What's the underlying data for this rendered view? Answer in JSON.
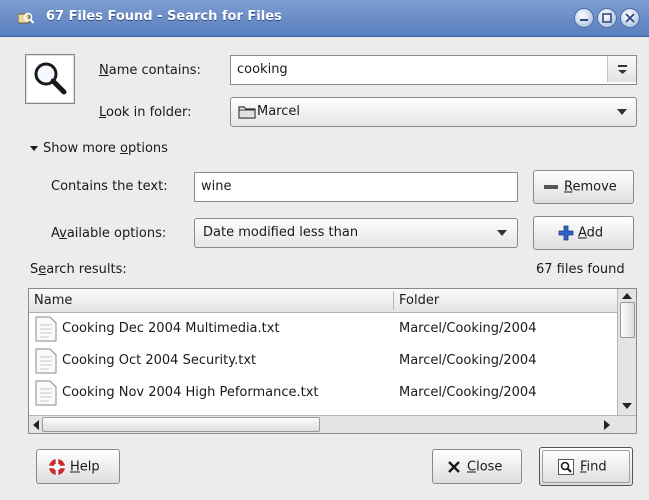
{
  "window": {
    "title": "67 Files Found - Search for Files"
  },
  "name_contains": {
    "label_pre": "",
    "label_ul": "N",
    "label_post": "ame contains:",
    "value": "cooking"
  },
  "look_in": {
    "label_pre": "",
    "label_ul": "L",
    "label_post": "ook in folder:",
    "value": "Marcel"
  },
  "more_options": {
    "label_pre": "Show more ",
    "label_ul": "o",
    "label_post": "ptions"
  },
  "contains_text": {
    "label": "Contains the text:",
    "value": "wine"
  },
  "remove_button": {
    "label_ul": "R",
    "label_post": "emove"
  },
  "available_options": {
    "label_pre": "A",
    "label_ul": "v",
    "label_post": "ailable options:",
    "value": "Date modified less than"
  },
  "add_button": {
    "label_ul": "A",
    "label_post": "dd"
  },
  "results": {
    "label_pre": "S",
    "label_ul": "e",
    "label_post": "arch results:",
    "count": "67 files found",
    "columns": [
      "Name",
      "Folder"
    ],
    "rows": [
      {
        "name": "Cooking Dec 2004 Multimedia.txt",
        "folder": "Marcel/Cooking/2004"
      },
      {
        "name": "Cooking Oct 2004 Security.txt",
        "folder": "Marcel/Cooking/2004"
      },
      {
        "name": "Cooking Nov 2004 High Peformance.txt",
        "folder": "Marcel/Cooking/2004"
      }
    ]
  },
  "buttons": {
    "help": {
      "label_ul": "H",
      "label_post": "elp"
    },
    "close": {
      "label_ul": "C",
      "label_post": "lose"
    },
    "find": {
      "label_ul": "F",
      "label_post": "ind"
    }
  },
  "colors": {
    "titlebar": "#5a7fc0",
    "add_icon": "#2f62c2",
    "help_icon": "#c92b2b"
  }
}
